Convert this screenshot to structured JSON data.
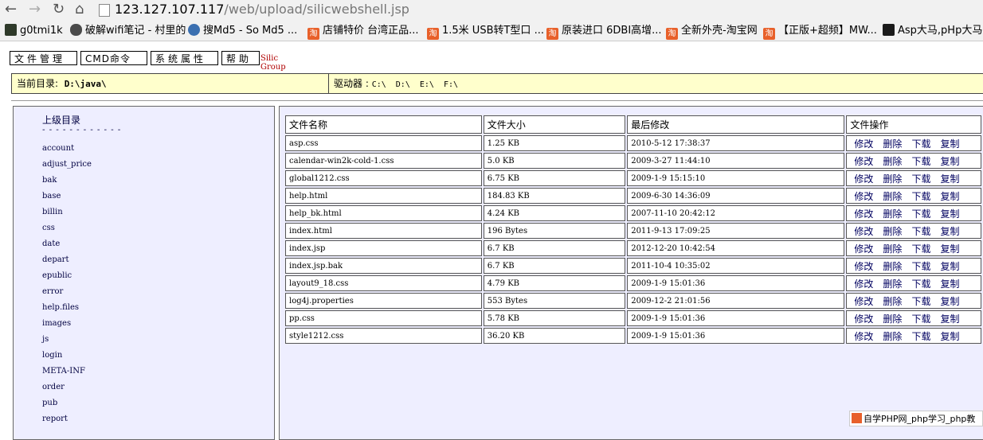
{
  "browser": {
    "url_host": "123.127.107.117",
    "url_path": "/web/upload/silicwebshell.jsp",
    "bookmarks": [
      {
        "label": "g0tmi1k",
        "icon": "dark"
      },
      {
        "label": "破解wifi笔记 - 村里的",
        "icon": "bug"
      },
      {
        "label": "搜Md5 - So Md5 ...",
        "icon": "md5"
      },
      {
        "label": "店铺特价 台湾正品...",
        "icon": "tao"
      },
      {
        "label": "1.5米 USB转T型口 ...",
        "icon": "tao"
      },
      {
        "label": "原装进口 6DBI高增...",
        "icon": "tao"
      },
      {
        "label": "全新外壳-淘宝网",
        "icon": "tao"
      },
      {
        "label": "【正版+超频】MW...",
        "icon": "tao"
      },
      {
        "label": "Asp大马,pHp大马,...",
        "icon": "asp"
      }
    ]
  },
  "menu": {
    "file_manager": "文件管理",
    "cmd": "CMD命令",
    "sys_props": "系统属性",
    "help": "帮助",
    "brand": "Silic Group"
  },
  "dirbar": {
    "current_label": "当前目录:",
    "current_path": "D:\\java\\",
    "drives_label": "驱动器 :",
    "drives": "C:\\  D:\\  E:\\  F:\\"
  },
  "sidebar": {
    "up_label": "上级目录",
    "dashes": "------------",
    "dirs": [
      "account",
      "adjust_price",
      "bak",
      "base",
      "billin",
      "css",
      "date",
      "depart",
      "epublic",
      "error",
      "help.files",
      "images",
      "js",
      "login",
      "META-INF",
      "order",
      "pub",
      "report"
    ]
  },
  "files": {
    "headers": [
      "文件名称",
      "文件大小",
      "最后修改",
      "文件操作"
    ],
    "ops": [
      "修改",
      "删除",
      "下载",
      "复制"
    ],
    "rows": [
      {
        "name": "asp.css",
        "size": "1.25 KB",
        "modified": "2010-5-12 17:38:37"
      },
      {
        "name": "calendar-win2k-cold-1.css",
        "size": "5.0 KB",
        "modified": "2009-3-27 11:44:10"
      },
      {
        "name": "global1212.css",
        "size": "6.75 KB",
        "modified": "2009-1-9 15:15:10"
      },
      {
        "name": "help.html",
        "size": "184.83 KB",
        "modified": "2009-6-30 14:36:09"
      },
      {
        "name": "help_bk.html",
        "size": "4.24 KB",
        "modified": "2007-11-10 20:42:12"
      },
      {
        "name": "index.html",
        "size": "196 Bytes",
        "modified": "2011-9-13 17:09:25"
      },
      {
        "name": "index.jsp",
        "size": "6.7 KB",
        "modified": "2012-12-20 10:42:54"
      },
      {
        "name": "index.jsp.bak",
        "size": "6.7 KB",
        "modified": "2011-10-4 10:35:02"
      },
      {
        "name": "layout9_18.css",
        "size": "4.79 KB",
        "modified": "2009-1-9 15:01:36"
      },
      {
        "name": "log4j.properties",
        "size": "553 Bytes",
        "modified": "2009-12-2 21:01:56"
      },
      {
        "name": "pp.css",
        "size": "5.78 KB",
        "modified": "2009-1-9 15:01:36"
      },
      {
        "name": "style1212.css",
        "size": "36.20 KB",
        "modified": "2009-1-9 15:01:36"
      }
    ]
  },
  "watermark": "自学PHP网_php学习_php教"
}
